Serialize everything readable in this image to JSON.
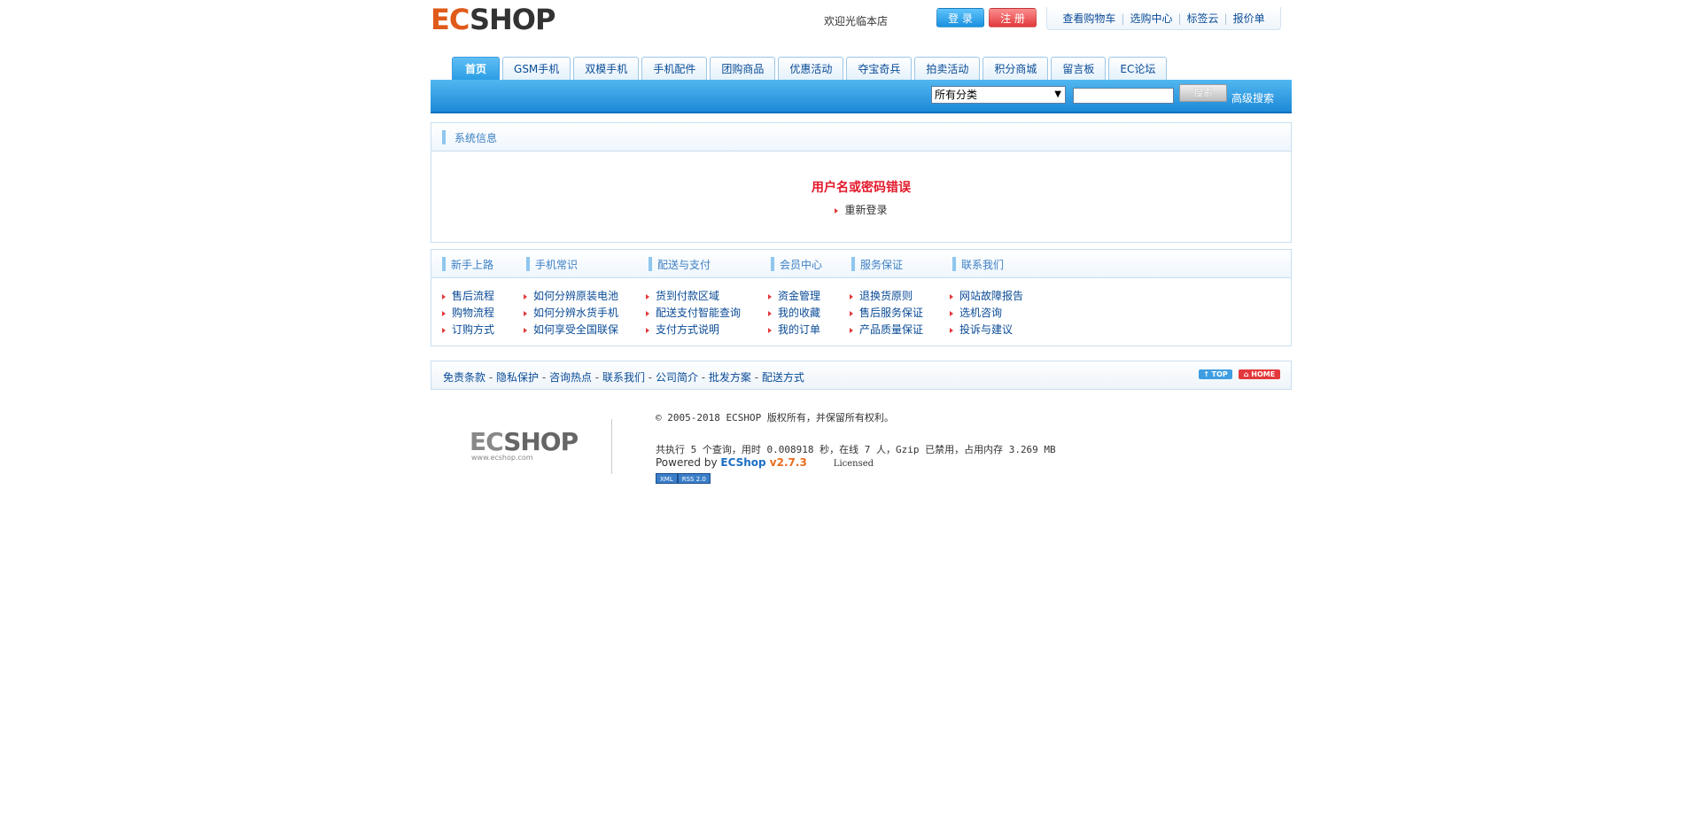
{
  "header": {
    "logo_text_a": "EC",
    "logo_text_b": "SHOP",
    "welcome": "欢迎光临本店",
    "login_label": "登 录",
    "register_label": "注 册",
    "toplinks": [
      "查看购物车",
      "选购中心",
      "标签云",
      "报价单"
    ]
  },
  "nav": {
    "tabs": [
      "首页",
      "GSM手机",
      "双模手机",
      "手机配件",
      "团购商品",
      "优惠活动",
      "夺宝奇兵",
      "拍卖活动",
      "积分商城",
      "留言板",
      "EC论坛"
    ],
    "active_index": 0
  },
  "search": {
    "category_selected": "所有分类",
    "keyword_value": "",
    "button_label": "搜索",
    "advanced_label": "高级搜索"
  },
  "message": {
    "section_title": "系统信息",
    "title": "用户名或密码错误",
    "link_label": "重新登录"
  },
  "help": {
    "columns": [
      {
        "title": "新手上路",
        "items": [
          "售后流程",
          "购物流程",
          "订购方式"
        ]
      },
      {
        "title": "手机常识",
        "items": [
          "如何分辨原装电池",
          "如何分辨水货手机",
          "如何享受全国联保"
        ]
      },
      {
        "title": "配送与支付",
        "items": [
          "货到付款区域",
          "配送支付智能查询",
          "支付方式说明"
        ]
      },
      {
        "title": "会员中心",
        "items": [
          "资金管理",
          "我的收藏",
          "我的订单"
        ]
      },
      {
        "title": "服务保证",
        "items": [
          "退换货原则",
          "售后服务保证",
          "产品质量保证"
        ]
      },
      {
        "title": "联系我们",
        "items": [
          "网站故障报告",
          "选机咨询",
          "投诉与建议"
        ]
      }
    ]
  },
  "footer": {
    "links": [
      "免责条款",
      "隐私保护",
      "咨询热点",
      "联系我们",
      "公司简介",
      "批发方案",
      "配送方式"
    ],
    "top_label": "↑ TOP",
    "home_label": "⌂ HOME",
    "logo_a": "EC",
    "logo_b": "SHOP",
    "logo_url_text": "www.ecshop.com",
    "copyright": "© 2005-2018 ECSHOP 版权所有，并保留所有权利。",
    "stats": "共执行 5 个查询，用时 0.008918 秒，在线 7 人，Gzip 已禁用，占用内存 3.269 MB",
    "powered_prefix": "Powered by ",
    "powered_brand": "ECShop",
    "powered_version": " v2.7.3",
    "licensed": "Licensed",
    "badge_xml": "XML",
    "badge_rss": "RSS 2.0"
  }
}
